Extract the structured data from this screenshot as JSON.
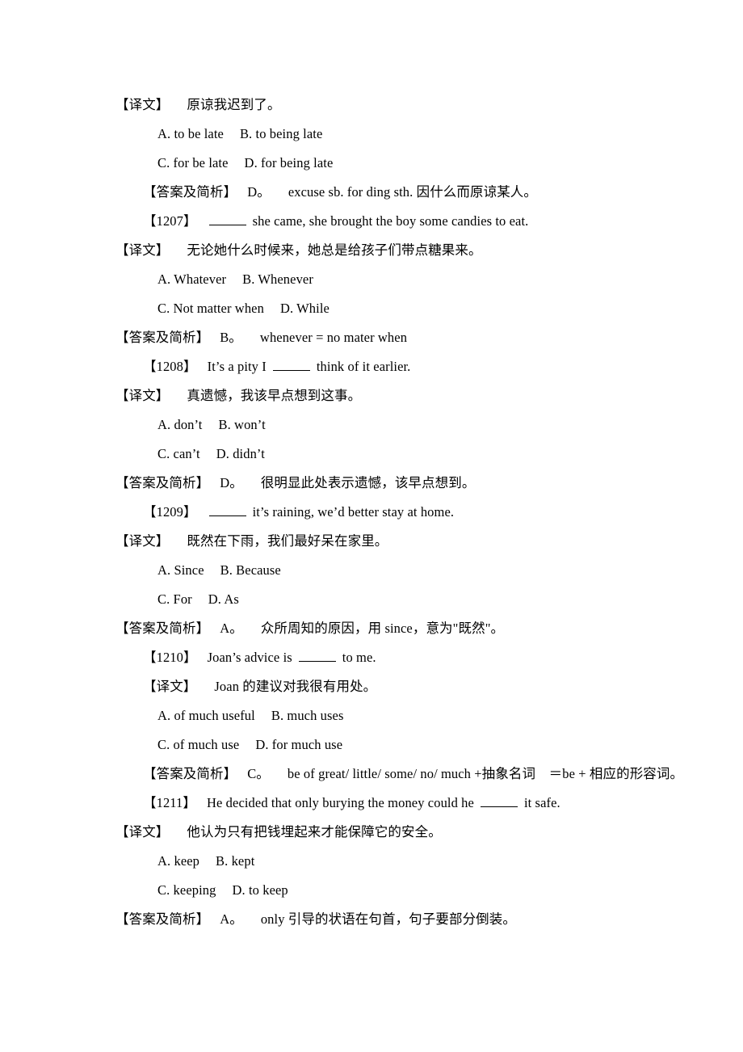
{
  "document": {
    "labels": {
      "translation": "【译文】",
      "answer": "【答案及简析】"
    },
    "entries": [
      {
        "translation_text": "原谅我迟到了。",
        "options": [
          {
            "left": "A. to be late",
            "right": "B. to being late"
          },
          {
            "left": "C. for be late",
            "right": "D. for being late"
          }
        ],
        "answer_choice": "D。",
        "answer_text": "excuse sb. for ding sth. 因什么而原谅某人。"
      },
      {
        "number": "【1207】",
        "stem_before": "",
        "stem_after": "she came, she brought the boy some candies to eat.",
        "translation_text": "无论她什么时候来，她总是给孩子们带点糖果来。",
        "options": [
          {
            "left": "A. Whatever",
            "right": "B. Whenever"
          },
          {
            "left": "C. Not matter when",
            "right": "D. While"
          }
        ],
        "answer_choice": "B。",
        "answer_text": "whenever = no mater when"
      },
      {
        "number": "【1208】",
        "stem_before": "It’s a pity I",
        "stem_after": "think of it earlier.",
        "translation_text": "真遗憾，我该早点想到这事。",
        "options": [
          {
            "left": "A. don’t",
            "right": "B. won’t"
          },
          {
            "left": "C. can’t",
            "right": "D. didn’t"
          }
        ],
        "answer_choice": "D。",
        "answer_text": "很明显此处表示遗憾，该早点想到。"
      },
      {
        "number": "【1209】",
        "stem_before": "",
        "stem_after": "it’s raining, we’d better stay at home.",
        "translation_text": "既然在下雨，我们最好呆在家里。",
        "options": [
          {
            "left": "A. Since",
            "right": "B. Because"
          },
          {
            "left": "C. For",
            "right": "D. As"
          }
        ],
        "answer_choice": "A。",
        "answer_text": "众所周知的原因，用 since，意为\"既然\"。"
      },
      {
        "number": "【1210】",
        "stem_before": "Joan’s advice is",
        "stem_after": "to me.",
        "translation_text": "Joan 的建议对我很有用处。",
        "options": [
          {
            "left": "A. of much useful",
            "right": "B. much uses"
          },
          {
            "left": "C. of much use",
            "right": "D. for much use"
          }
        ],
        "answer_choice": "C。",
        "answer_text": "be of great/ little/ some/ no/ much +抽象名词　＝be + 相应的形容词。"
      },
      {
        "number": "【1211】",
        "stem_before": "He decided that only burying the money could he",
        "stem_after": "it safe.",
        "translation_text": "他认为只有把钱埋起来才能保障它的安全。",
        "options": [
          {
            "left": "A. keep",
            "right": "B. kept"
          },
          {
            "left": "C. keeping",
            "right": "D. to keep"
          }
        ],
        "answer_choice": "A。",
        "answer_text": "only 引导的状语在句首，句子要部分倒装。"
      }
    ]
  }
}
